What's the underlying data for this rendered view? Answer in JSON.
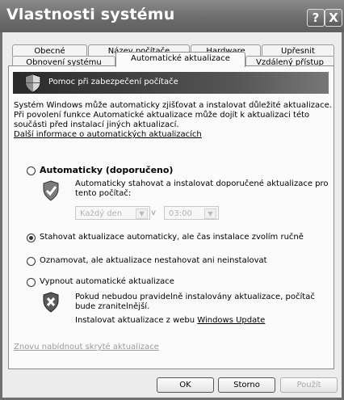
{
  "window": {
    "title": "Vlastnosti systému",
    "help_glyph": "?",
    "close_glyph": "X"
  },
  "tabs_row1": [
    "Obecné",
    "Název počítače",
    "Hardware",
    "Upřesnit"
  ],
  "tabs_row2": [
    "Obnovení systému",
    "Automatické aktualizace",
    "Vzdálený přístup"
  ],
  "active_tab": "Automatické aktualizace",
  "banner": {
    "text": "Pomoc při zabezpečení počítače"
  },
  "intro": {
    "line1": "Systém Windows může automaticky zjišťovat a instalovat důležité aktualizace.",
    "line2": "Při povolení funkce Automatické aktualizace může dojít k aktualizaci této",
    "line3": "součásti před instalací jiných aktualizací.",
    "link": "Další informace o automatických aktualizacích"
  },
  "options": {
    "auto_label": "Automaticky (doporučeno)",
    "auto_desc1": "Automaticky stahovat a instalovat doporučené aktualizace pro",
    "auto_desc2": "tento počítač:",
    "day_value": "Každý den",
    "at_label": "v",
    "time_value": "03:00",
    "download_label": "Stahovat aktualizace automaticky, ale čas instalace zvolím ručně",
    "notify_label": "Oznamovat, ale aktualizace nestahovat ani neinstalovat",
    "off_label": "Vypnout automatické aktualizace",
    "off_desc1": "Pokud nebudou pravidelně instalovány aktualizace, počítač",
    "off_desc2": "bude zranitelnější.",
    "off_desc3": "Instalovat aktualizace z webu",
    "off_link": "Windows Update",
    "selected": "download"
  },
  "offer_again_link": "Znovu nabídnout skryté aktualizace",
  "buttons": {
    "ok": "OK",
    "cancel": "Storno",
    "apply": "Použít"
  }
}
